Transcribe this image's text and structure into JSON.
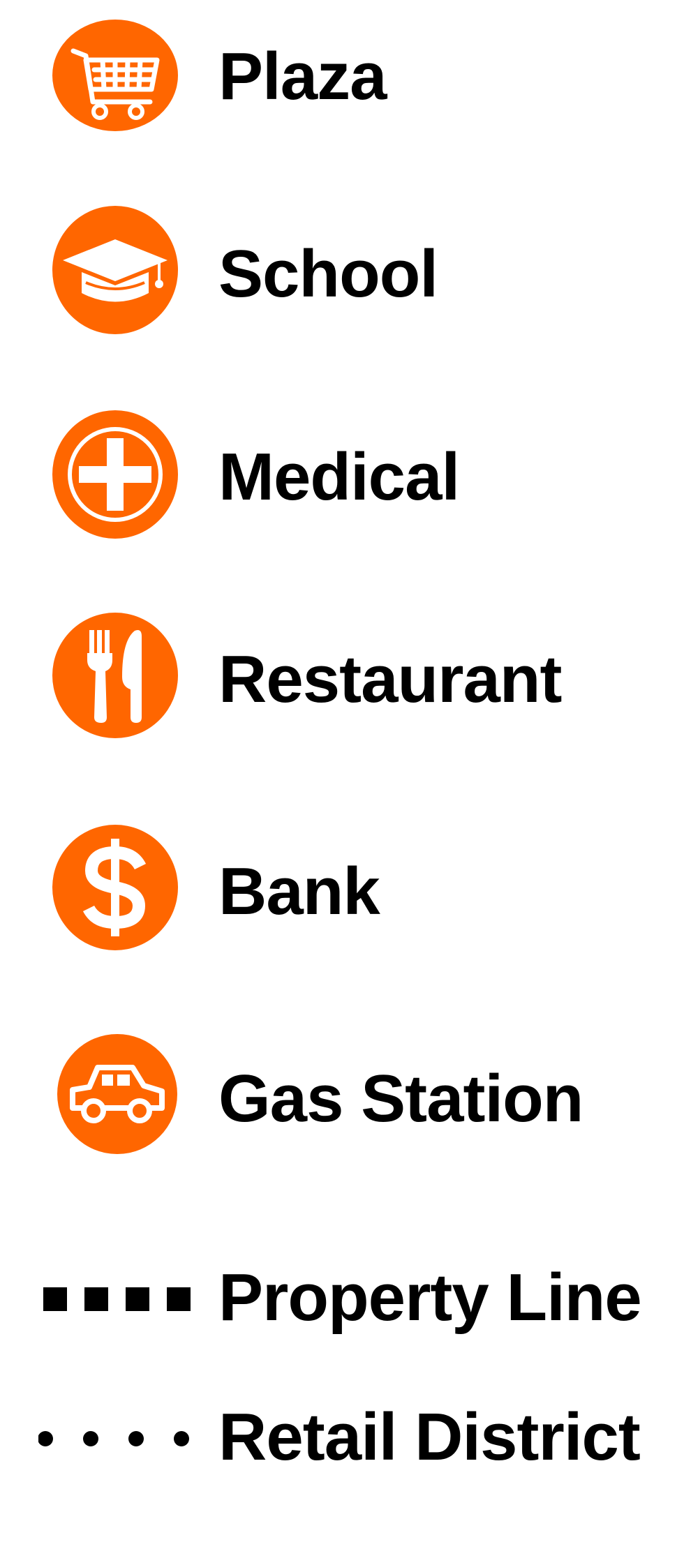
{
  "colors": {
    "accent": "#FF6600",
    "icon_fg": "#FFFFFF",
    "text": "#000000"
  },
  "legend": {
    "items": [
      {
        "label": "Plaza",
        "icon": "shopping-cart-icon"
      },
      {
        "label": "School",
        "icon": "graduation-cap-icon"
      },
      {
        "label": "Medical",
        "icon": "medical-cross-icon"
      },
      {
        "label": "Restaurant",
        "icon": "fork-knife-icon"
      },
      {
        "label": "Bank",
        "icon": "dollar-sign-icon"
      },
      {
        "label": "Gas Station",
        "icon": "car-icon"
      }
    ],
    "lines": [
      {
        "label": "Property Line",
        "style": "dashed-squares"
      },
      {
        "label": "Retail District",
        "style": "dotted"
      }
    ]
  }
}
